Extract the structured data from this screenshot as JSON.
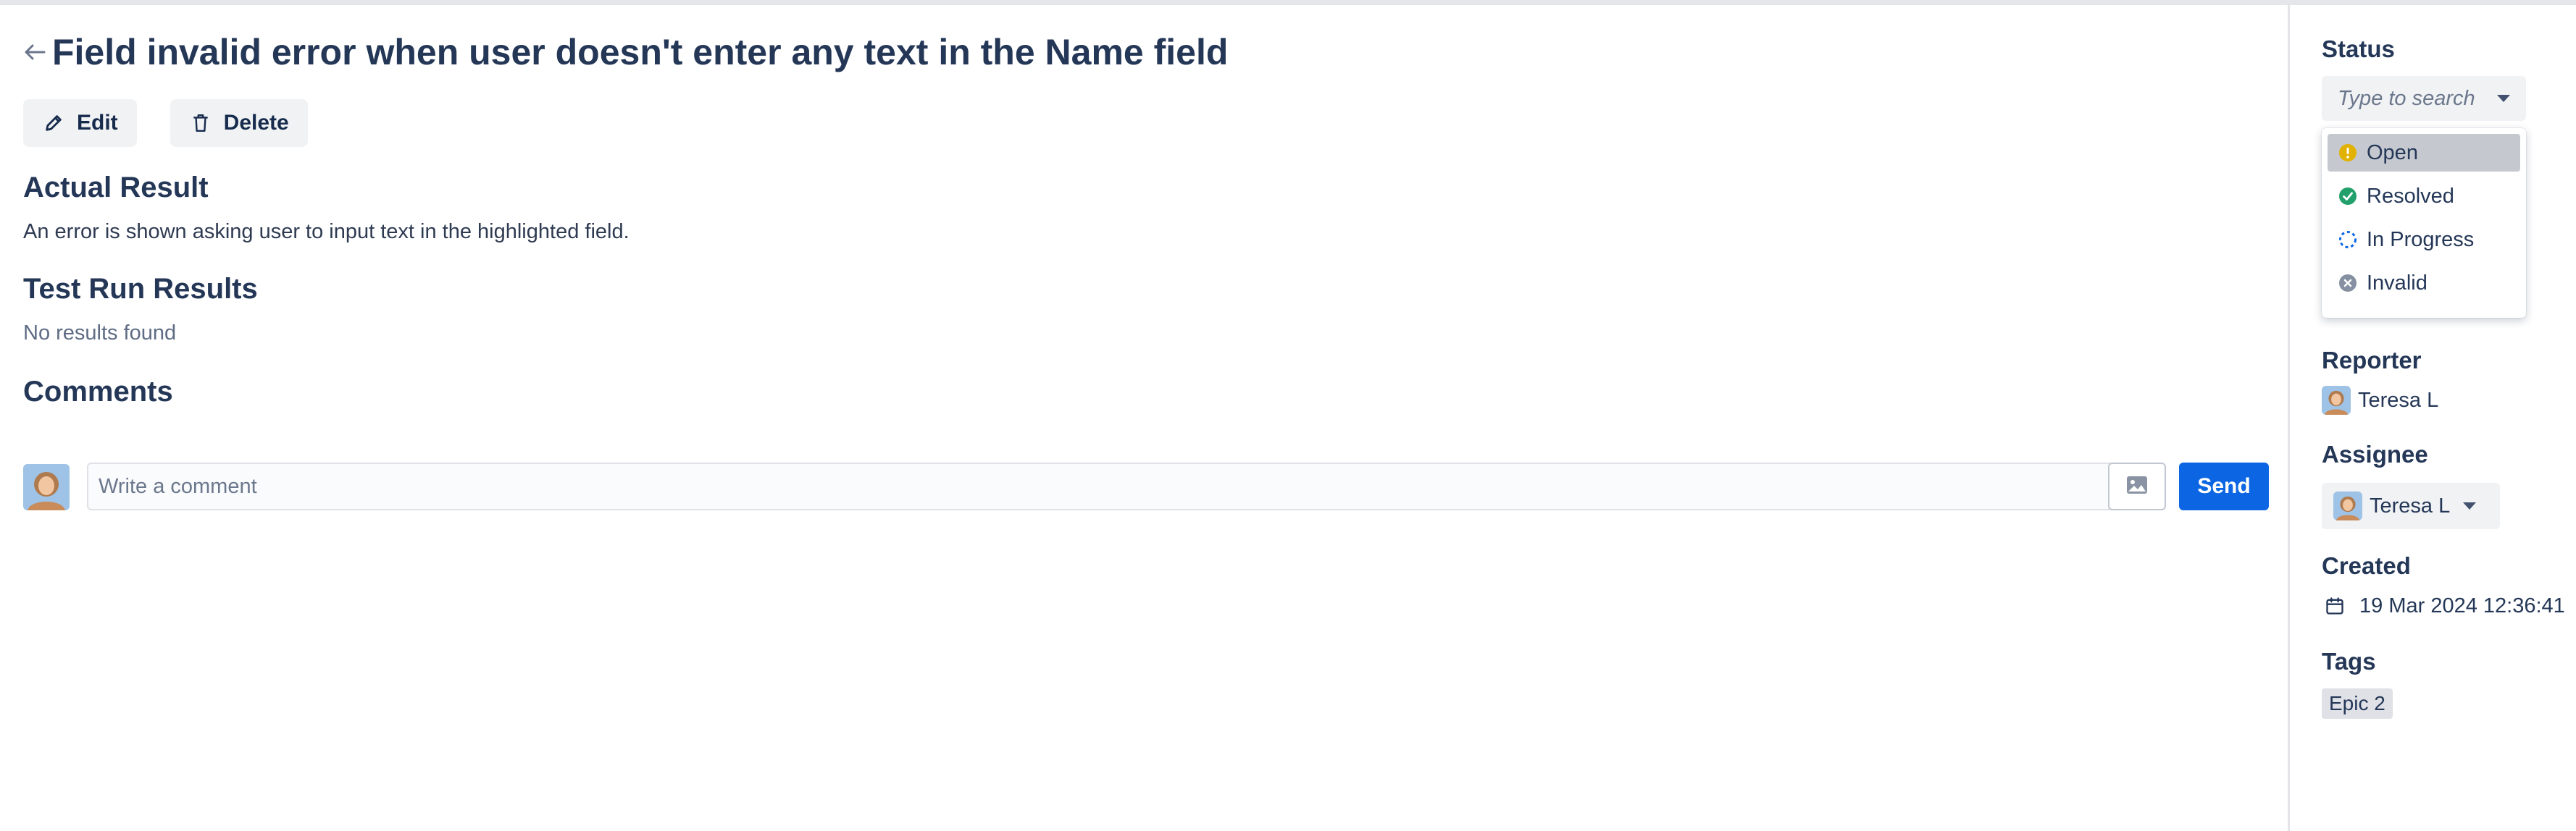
{
  "issue": {
    "title": "Field invalid error when user doesn't enter any text in the Name field"
  },
  "actions": {
    "edit_label": "Edit",
    "delete_label": "Delete"
  },
  "actual_result": {
    "heading": "Actual Result",
    "text": "An error is shown asking user to input text in the highlighted field."
  },
  "test_run_results": {
    "heading": "Test Run Results",
    "empty_text": "No results found"
  },
  "comments": {
    "heading": "Comments",
    "placeholder": "Write a comment",
    "send_label": "Send"
  },
  "sidebar": {
    "status": {
      "label": "Status",
      "placeholder": "Type to search",
      "options": [
        {
          "label": "Open",
          "icon": "warning-circle-icon",
          "color": "#e2b203",
          "selected": true
        },
        {
          "label": "Resolved",
          "icon": "check-circle-icon",
          "color": "#22a06b",
          "selected": false
        },
        {
          "label": "In Progress",
          "icon": "progress-dashed-icon",
          "color": "#0c66e4",
          "selected": false
        },
        {
          "label": "Invalid",
          "icon": "x-circle-icon",
          "color": "#8590a2",
          "selected": false
        }
      ]
    },
    "reporter": {
      "label": "Reporter",
      "name": "Teresa L"
    },
    "assignee": {
      "label": "Assignee",
      "name": "Teresa L"
    },
    "created": {
      "label": "Created",
      "value": "19 Mar 2024 12:36:41"
    },
    "tags": {
      "label": "Tags",
      "items": [
        "Epic 2"
      ]
    }
  },
  "colors": {
    "primary": "#0c66e4",
    "heading": "#243757",
    "selected_option_bg": "#c5c9cf"
  }
}
